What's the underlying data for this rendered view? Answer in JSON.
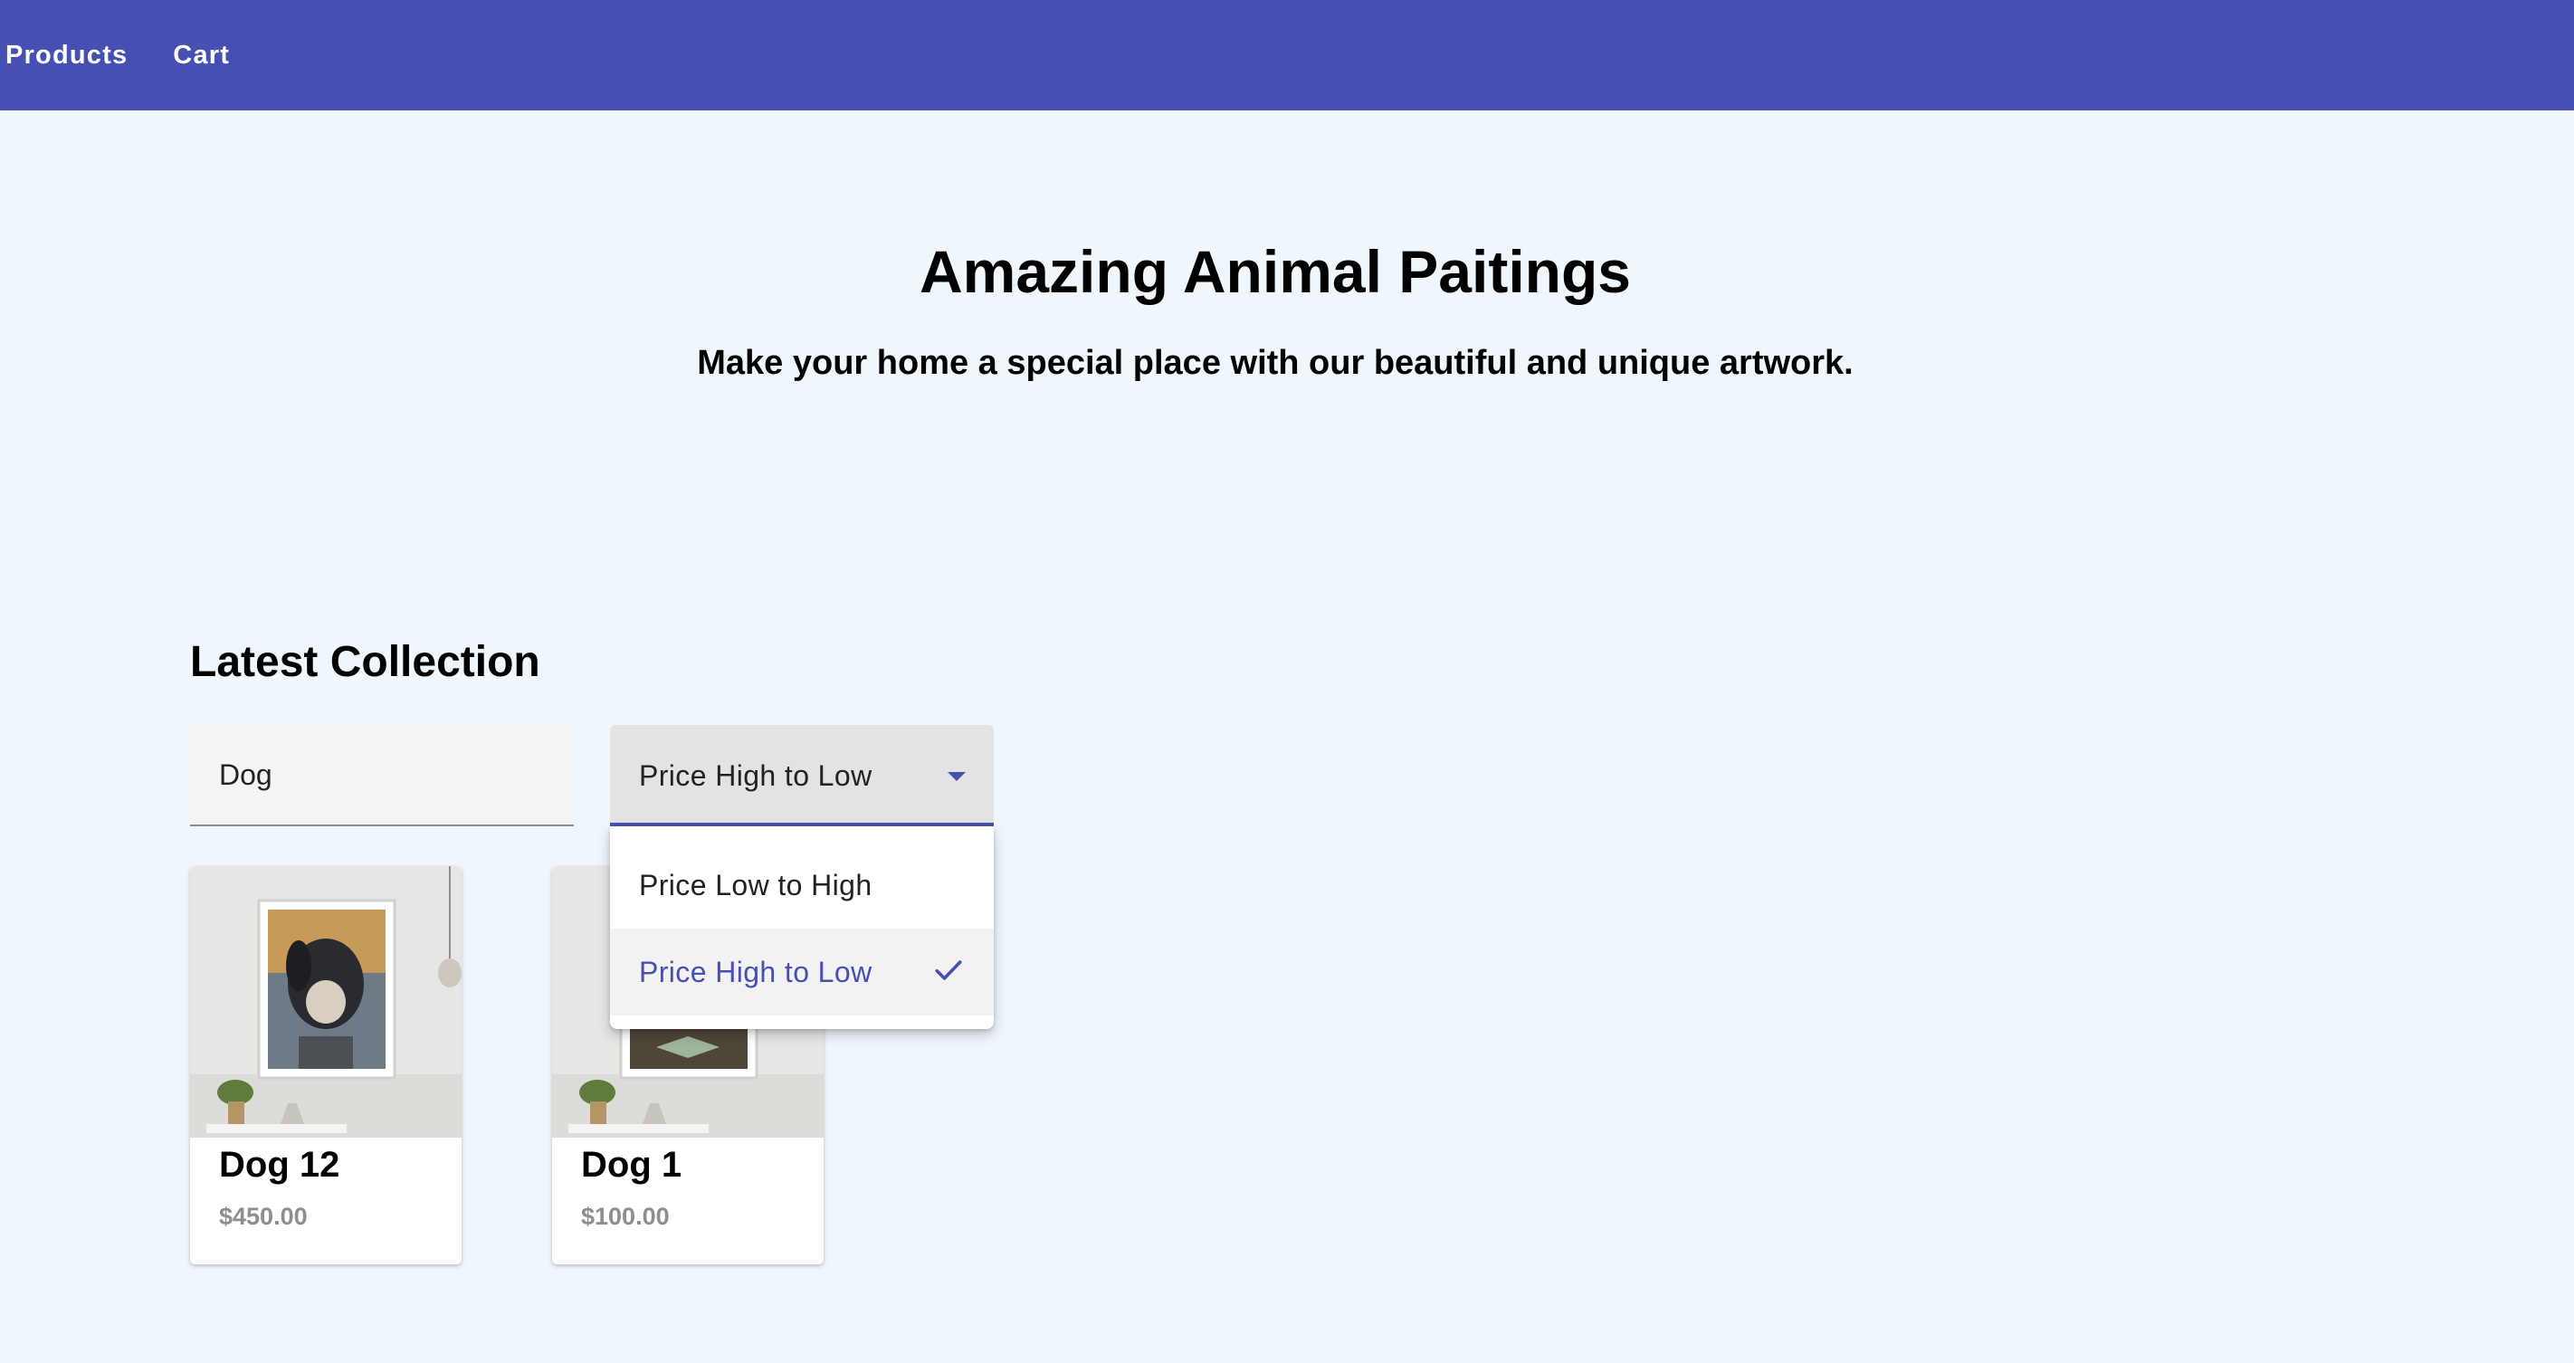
{
  "nav": {
    "products_label": "Products",
    "cart_label": "Cart"
  },
  "hero": {
    "title": "Amazing Animal Paitings",
    "subtitle": "Make your home a special place with our beautiful and unique artwork."
  },
  "collection": {
    "title": "Latest Collection",
    "search_value": "Dog",
    "sort": {
      "selected": "Price High to Low",
      "options": [
        "Price Low to High",
        "Price High to Low"
      ]
    },
    "products": [
      {
        "name": "Dog 12",
        "price": "$450.00"
      },
      {
        "name": "Dog 1",
        "price": "$100.00"
      }
    ]
  },
  "colors": {
    "primary": "#4550b2",
    "background": "#eff6fc",
    "price_text": "#8e8e8e"
  },
  "icons": {
    "dropdown": "caret-down-icon",
    "selected": "check-icon"
  }
}
